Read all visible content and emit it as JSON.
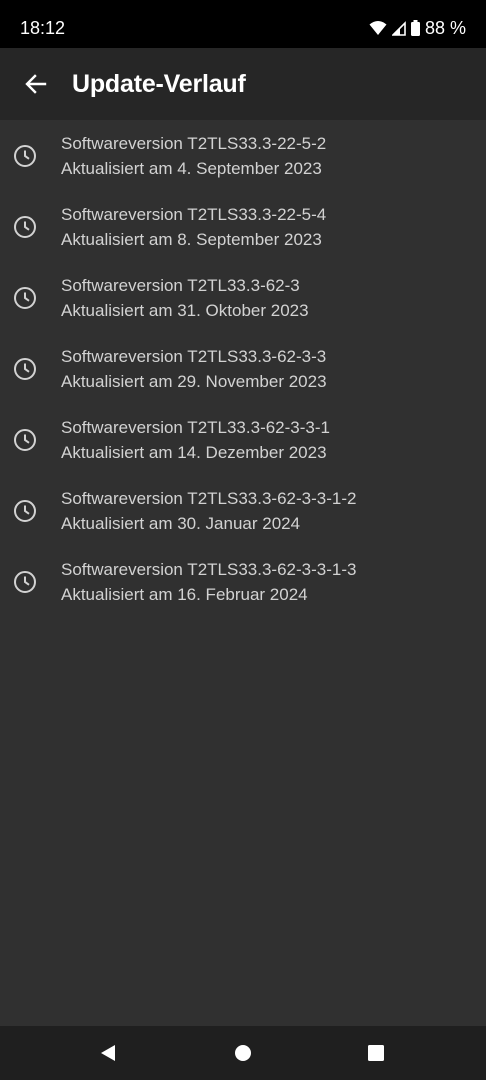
{
  "status_bar": {
    "time": "18:12",
    "battery_text": "88 %",
    "icons": [
      "wifi-icon",
      "cellular-signal-icon",
      "battery-icon"
    ]
  },
  "app_bar": {
    "title": "Update-Verlauf",
    "back_icon": "arrow-back-icon"
  },
  "updates": [
    {
      "title": "Softwareversion T2TLS33.3-22-5-2",
      "subtitle": "Aktualisiert am 4. September 2023",
      "icon": "clock-icon"
    },
    {
      "title": "Softwareversion T2TLS33.3-22-5-4",
      "subtitle": "Aktualisiert am 8. September 2023",
      "icon": "clock-icon"
    },
    {
      "title": "Softwareversion T2TL33.3-62-3",
      "subtitle": "Aktualisiert am 31. Oktober 2023",
      "icon": "clock-icon"
    },
    {
      "title": "Softwareversion T2TLS33.3-62-3-3",
      "subtitle": "Aktualisiert am 29. November 2023",
      "icon": "clock-icon"
    },
    {
      "title": "Softwareversion T2TL33.3-62-3-3-1",
      "subtitle": "Aktualisiert am 14. Dezember 2023",
      "icon": "clock-icon"
    },
    {
      "title": "Softwareversion T2TLS33.3-62-3-3-1-2",
      "subtitle": "Aktualisiert am 30. Januar 2024",
      "icon": "clock-icon"
    },
    {
      "title": "Softwareversion T2TLS33.3-62-3-3-1-3",
      "subtitle": "Aktualisiert am 16. Februar 2024",
      "icon": "clock-icon"
    }
  ],
  "nav_bar": {
    "buttons": [
      "back-triangle-icon",
      "home-circle-icon",
      "recents-square-icon"
    ]
  },
  "colors": {
    "background": "#303030",
    "app_bar": "#262626",
    "status_bar": "#000000",
    "nav_bar": "#1f1f1f",
    "text": "#d2d2d2"
  }
}
